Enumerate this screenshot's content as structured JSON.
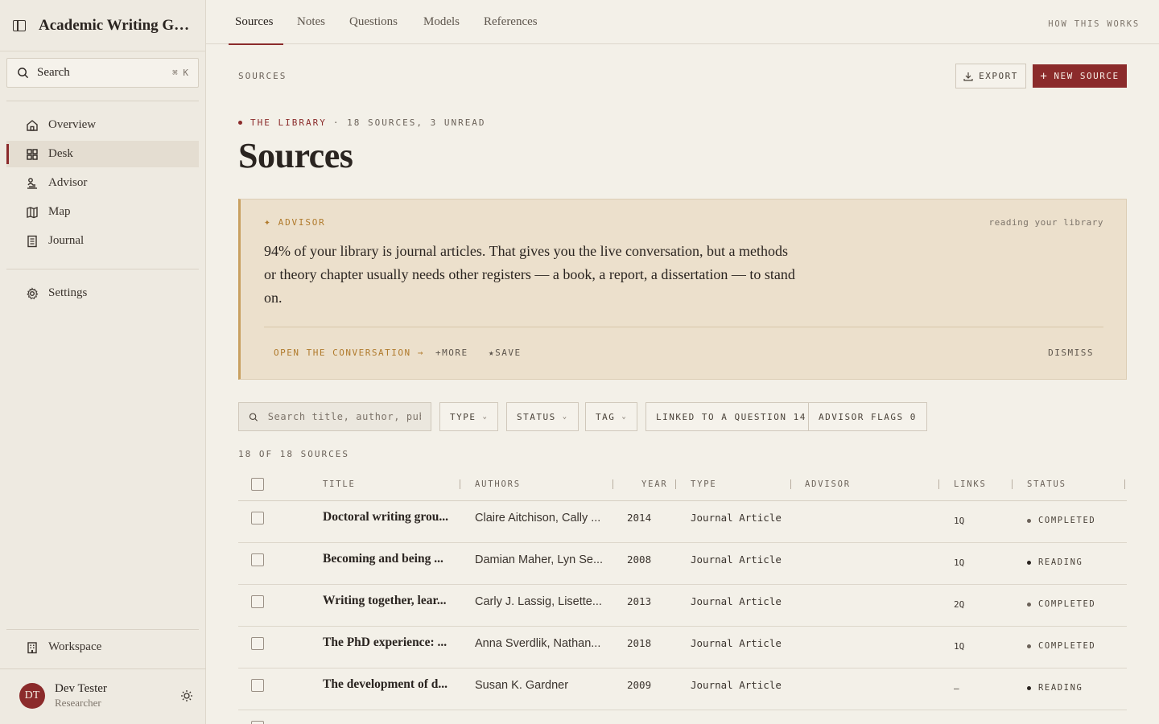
{
  "sidebar": {
    "workspace_title": "Academic Writing Gro...",
    "search_label": "Search",
    "search_shortcut": "⌘ K",
    "nav": [
      {
        "label": "Overview",
        "icon": "home-icon"
      },
      {
        "label": "Desk",
        "icon": "grid-icon",
        "active": true
      },
      {
        "label": "Advisor",
        "icon": "advisor-icon"
      },
      {
        "label": "Map",
        "icon": "map-icon"
      },
      {
        "label": "Journal",
        "icon": "journal-icon"
      }
    ],
    "settings_label": "Settings",
    "workspace_label": "Workspace",
    "user": {
      "initials": "DT",
      "name": "Dev Tester",
      "role": "Researcher"
    }
  },
  "tabs": [
    "Sources",
    "Notes",
    "Questions",
    "Models",
    "References"
  ],
  "active_tab": "Sources",
  "how_it_works": "HOW THIS WORKS",
  "page": {
    "crumb": "SOURCES",
    "export_label": "EXPORT",
    "new_source_label": "NEW SOURCE",
    "kicker_library": "THE LIBRARY",
    "kicker_stats": "· 18 SOURCES, 3 UNREAD",
    "title": "Sources"
  },
  "advisor": {
    "label": "ADVISOR",
    "status": "reading your library",
    "message": "94% of your library is journal articles. That gives you the live conversation, but a methods or theory chapter usually needs other registers — a book, a report, a dissertation — to stand on.",
    "open_label": "OPEN THE CONVERSATION →",
    "more_label": "+MORE",
    "save_label": "★SAVE",
    "dismiss_label": "DISMISS"
  },
  "filters": {
    "search_placeholder": "Search title, author, publ:",
    "type": "TYPE",
    "status": "STATUS",
    "tag": "TAG",
    "linked": "LINKED TO A QUESTION 14",
    "flags": "ADVISOR FLAGS 0"
  },
  "count_label": "18 OF 18 SOURCES",
  "table": {
    "headers": {
      "title": "TITLE",
      "authors": "AUTHORS",
      "year": "YEAR",
      "type": "TYPE",
      "advisor": "ADVISOR",
      "links": "LINKS",
      "status": "STATUS"
    },
    "rows": [
      {
        "title": "Doctoral writing grou...",
        "authors": "Claire Aitchison, Cally ...",
        "year": "2014",
        "type": "Journal Article",
        "links": "1Q",
        "status": "COMPLETED"
      },
      {
        "title": "Becoming and being ...",
        "authors": "Damian Maher, Lyn Se...",
        "year": "2008",
        "type": "Journal Article",
        "links": "1Q",
        "status": "READING"
      },
      {
        "title": "Writing together, lear...",
        "authors": "Carly J. Lassig, Lisette...",
        "year": "2013",
        "type": "Journal Article",
        "links": "2Q",
        "status": "COMPLETED"
      },
      {
        "title": "The PhD experience: ...",
        "authors": "Anna Sverdlik, Nathan...",
        "year": "2018",
        "type": "Journal Article",
        "links": "1Q",
        "status": "COMPLETED"
      },
      {
        "title": "The development of d...",
        "authors": "Susan K. Gardner",
        "year": "2009",
        "type": "Journal Article",
        "links": "–",
        "status": "READING"
      }
    ]
  }
}
